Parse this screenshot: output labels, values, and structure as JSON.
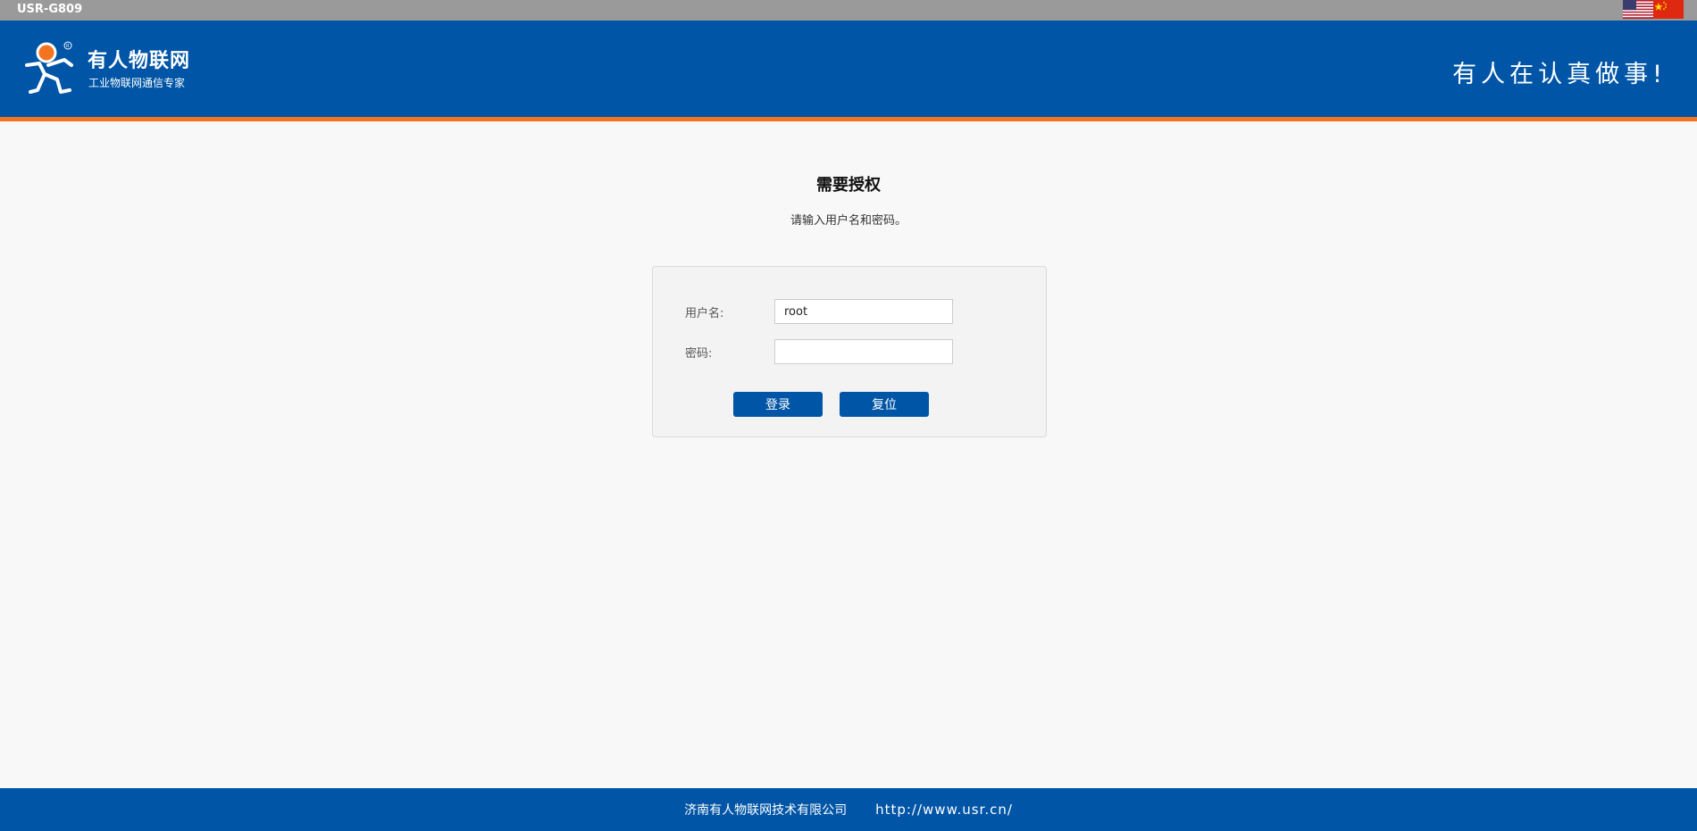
{
  "topbar": {
    "device_name": "USR-G809",
    "languages": [
      {
        "name": "English",
        "icon": "us-flag-icon"
      },
      {
        "name": "Chinese",
        "icon": "cn-flag-icon"
      }
    ]
  },
  "header": {
    "brand_name": "有人物联网",
    "brand_tagline": "工业物联网通信专家",
    "slogan": "有人在认真做事!",
    "logo_icon": "usr-mascot-logo-icon",
    "colors": {
      "primary": "#0055a6",
      "accent": "#f47321"
    }
  },
  "auth": {
    "title": "需要授权",
    "description": "请输入用户名和密码。",
    "username_label": "用户名:",
    "username_value": "root",
    "password_label": "密码:",
    "password_value": "",
    "login_label": "登录",
    "reset_label": "复位"
  },
  "footer": {
    "company": "济南有人物联网技术有限公司",
    "url": "http://www.usr.cn/"
  }
}
